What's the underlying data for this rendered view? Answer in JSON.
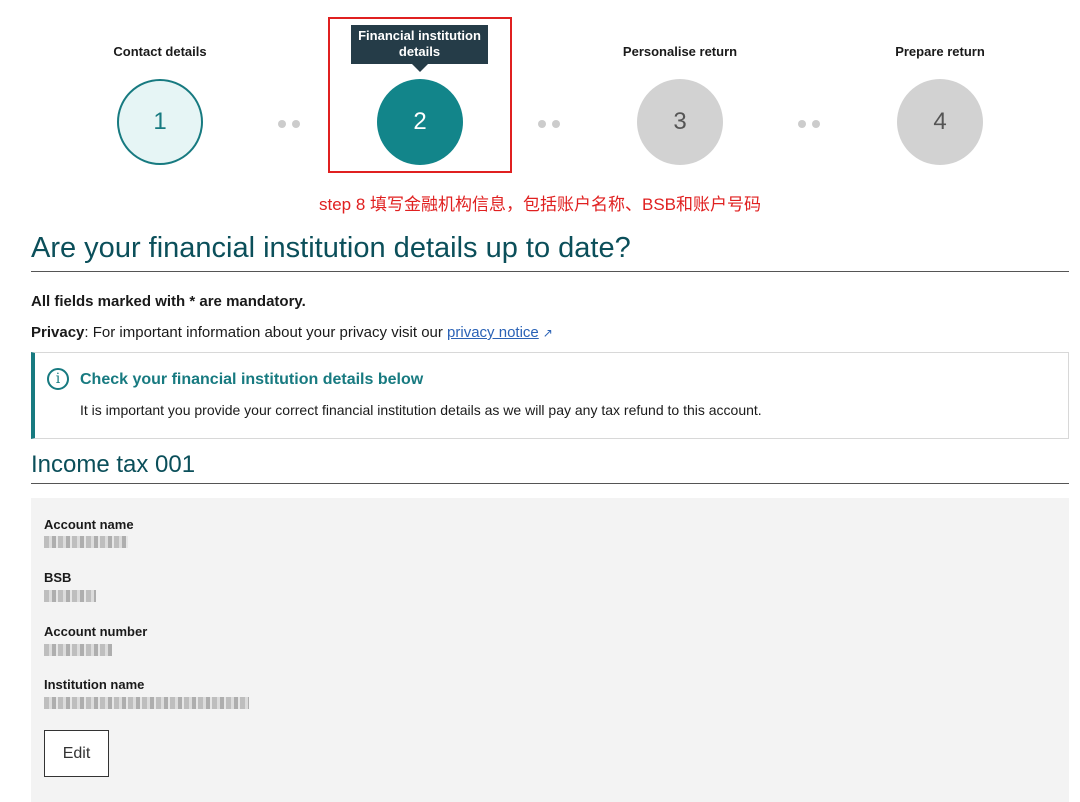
{
  "steps": [
    {
      "label": "Contact details",
      "number": "1",
      "state": "completed"
    },
    {
      "label": "Financial institution details",
      "number": "2",
      "state": "active"
    },
    {
      "label": "Personalise return",
      "number": "3",
      "state": "upcoming"
    },
    {
      "label": "Prepare return",
      "number": "4",
      "state": "upcoming"
    }
  ],
  "annotation": "step 8 填写金融机构信息，包括账户名称、BSB和账户号码",
  "page_title": "Are your financial institution details up to date?",
  "mandatory_note": "All fields marked with * are mandatory.",
  "privacy": {
    "label": "Privacy",
    "text": ": For important information about your privacy visit our ",
    "link": "privacy notice"
  },
  "alert": {
    "title": "Check your financial institution details below",
    "text": "It is important you provide your correct financial institution details as we will pay any tax refund to this account."
  },
  "section_title": "Income tax 001",
  "fields": {
    "account_name": "Account name",
    "bsb": "BSB",
    "account_number": "Account number",
    "institution_name": "Institution name"
  },
  "edit_label": "Edit",
  "colors": {
    "accent": "#177a80",
    "active_step": "#12858a",
    "heading": "#0b4f5a",
    "annotation": "#e02020",
    "link": "#2a62b6"
  }
}
